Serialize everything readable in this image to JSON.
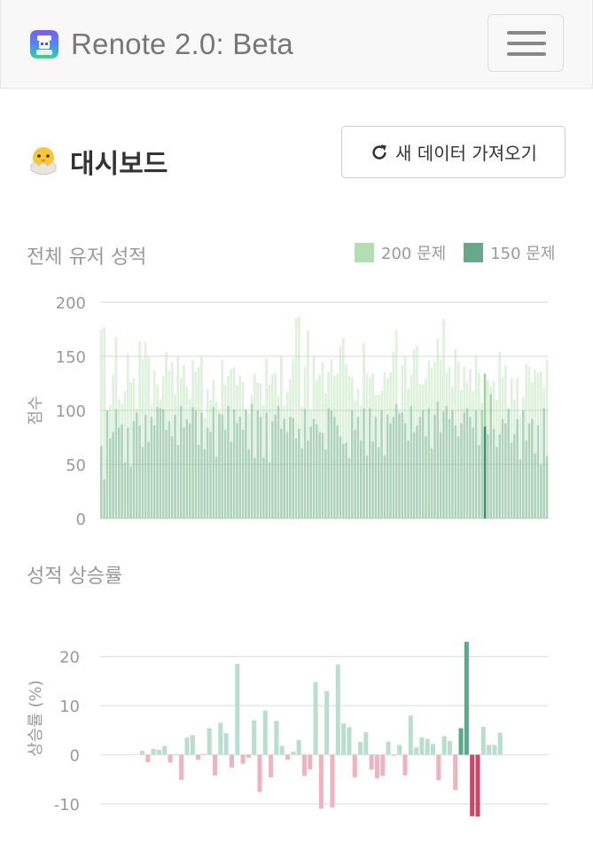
{
  "navbar": {
    "title": "Renote 2.0: Beta",
    "menu_icon": "hamburger-icon",
    "logo_icon": "app-logo-icon"
  },
  "page": {
    "title": "대시보드",
    "title_icon": "hatching-chick-icon",
    "refresh_label": "새 데이터 가져오기",
    "refresh_icon": "refresh-icon"
  },
  "colors": {
    "bar200": "#b3dfb0",
    "bar150": "#69a88a",
    "positive": "#b9ddcf",
    "negative": "#eeb3bf",
    "highlight_pos": "#5ea88a",
    "highlight_neg": "#c8476a"
  },
  "chart_data": [
    {
      "type": "bar",
      "title": "전체 유저 성적",
      "ylabel": "점수",
      "xlabel": "",
      "ylim": [
        0,
        200
      ],
      "yticks": [
        0,
        50,
        100,
        150,
        200
      ],
      "grid": true,
      "legend_position": "top-right",
      "series": [
        {
          "name": "200 문제",
          "values": [
            175,
            177,
            100,
            105,
            133,
            168,
            110,
            106,
            118,
            153,
            126,
            130,
            102,
            164,
            147,
            163,
            150,
            105,
            137,
            124,
            110,
            132,
            154,
            136,
            145,
            115,
            150,
            130,
            142,
            122,
            110,
            147,
            136,
            140,
            150,
            93,
            120,
            110,
            128,
            108,
            100,
            147,
            124,
            132,
            138,
            140,
            123,
            132,
            126,
            100,
            97,
            114,
            134,
            126,
            125,
            105,
            148,
            124,
            133,
            135,
            113,
            150,
            104,
            117,
            129,
            148,
            185,
            187,
            103,
            140,
            174,
            100,
            150,
            128,
            133,
            145,
            116,
            135,
            147,
            132,
            134,
            159,
            167,
            143,
            132,
            131,
            109,
            120,
            104,
            162,
            134,
            130,
            134,
            114,
            114,
            118,
            135,
            130,
            135,
            154,
            174,
            100,
            142,
            150,
            120,
            133,
            156,
            160,
            124,
            124,
            130,
            146,
            139,
            145,
            167,
            147,
            185,
            135,
            140,
            122,
            157,
            145,
            119,
            140,
            125,
            138,
            118,
            150,
            135,
            107,
            134,
            128,
            122,
            127,
            110,
            154,
            130,
            142,
            100,
            130,
            110,
            130,
            95,
            112,
            143,
            140,
            126,
            138,
            135,
            136,
            121,
            147
          ]
        },
        {
          "name": "150 문제",
          "values": [
            67,
            36,
            100,
            74,
            80,
            101,
            84,
            87,
            52,
            84,
            48,
            90,
            98,
            86,
            66,
            96,
            71,
            94,
            86,
            103,
            102,
            101,
            82,
            90,
            76,
            96,
            68,
            104,
            84,
            92,
            88,
            103,
            100,
            68,
            98,
            64,
            84,
            80,
            103,
            57,
            97,
            96,
            82,
            104,
            71,
            101,
            88,
            94,
            82,
            101,
            64,
            106,
            56,
            100,
            94,
            56,
            98,
            52,
            90,
            96,
            104,
            83,
            92,
            80,
            94,
            93,
            74,
            83,
            65,
            101,
            72,
            85,
            92,
            87,
            80,
            79,
            64,
            102,
            100,
            94,
            86,
            76,
            69,
            70,
            56,
            100,
            82,
            94,
            72,
            102,
            58,
            102,
            71,
            94,
            66,
            100,
            58,
            96,
            88,
            94,
            106,
            97,
            98,
            88,
            72,
            104,
            80,
            86,
            94,
            100,
            76,
            102,
            65,
            96,
            108,
            80,
            99,
            104,
            92,
            100,
            86,
            76,
            88,
            98,
            102,
            94,
            84,
            100,
            68,
            100,
            85,
            78,
            115,
            83,
            66,
            78,
            92,
            88,
            102,
            70,
            78,
            92,
            55,
            100,
            72,
            88,
            92,
            60,
            86,
            50,
            102,
            58
          ]
        }
      ],
      "highlight_index": 130
    },
    {
      "type": "bar",
      "title": "성적 상승률",
      "ylabel": "상승률 (%)",
      "xlabel": "",
      "ylim": [
        -12,
        25
      ],
      "yticks": [
        -10,
        0,
        10,
        20
      ],
      "grid": true,
      "values": [
        0.8,
        -1.5,
        1.2,
        1.0,
        1.8,
        -1.6,
        0.1,
        -5.1,
        3.5,
        4.0,
        -1.0,
        0.2,
        5.4,
        -4.2,
        6.5,
        4.4,
        -2.6,
        18.5,
        -1.8,
        -0.6,
        7.0,
        -7.6,
        9.0,
        -4.6,
        6.9,
        1.8,
        -1.0,
        0.6,
        3.0,
        -4.3,
        -3.0,
        14.8,
        -11.0,
        13.0,
        -10.7,
        18.4,
        6.4,
        5.6,
        -4.6,
        2.6,
        4.6,
        -3.0,
        -4.8,
        -4.3,
        2.7,
        -0.2,
        2.0,
        -4.2,
        8.0,
        1.5,
        3.5,
        3.2,
        2.2,
        -5.2,
        3.8,
        2.8,
        -7.2,
        5.4,
        23.0,
        -12.5,
        -12.6,
        5.7,
        2.0,
        2.0,
        4.5
      ],
      "highlight_indices": [
        57,
        58,
        59,
        60
      ]
    }
  ]
}
